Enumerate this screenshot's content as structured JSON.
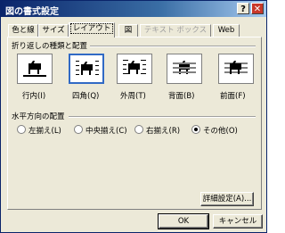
{
  "window": {
    "title": "図の書式設定",
    "help_glyph": "?",
    "close_glyph": "✕"
  },
  "tabs": [
    {
      "label": "色と線"
    },
    {
      "label": "サイズ"
    },
    {
      "label": "レイアウト"
    },
    {
      "label": "図"
    },
    {
      "label": "テキスト ボックス"
    },
    {
      "label": "Web"
    }
  ],
  "active_tab": "レイアウト",
  "wrapping": {
    "group_label": "折り返しの種類と配置",
    "selected": "四角(Q)",
    "options": [
      {
        "label": "行内(I)",
        "icon": "wrap-inline-icon"
      },
      {
        "label": "四角(Q)",
        "icon": "wrap-square-icon"
      },
      {
        "label": "外周(T)",
        "icon": "wrap-tight-icon"
      },
      {
        "label": "背面(B)",
        "icon": "wrap-behind-icon"
      },
      {
        "label": "前面(F)",
        "icon": "wrap-front-icon"
      }
    ]
  },
  "horizontal_alignment": {
    "group_label": "水平方向の配置",
    "selected": "その他(O)",
    "options": [
      {
        "label": "左揃え(L)"
      },
      {
        "label": "中央揃え(C)"
      },
      {
        "label": "右揃え(R)"
      },
      {
        "label": "その他(O)"
      }
    ]
  },
  "buttons": {
    "advanced": "詳細設定(A)...",
    "ok": "OK",
    "cancel": "キャンセル"
  },
  "colors": {
    "title_bar": "#0a246a",
    "dialog_bg": "#ece9d8",
    "selection": "#316ac5"
  }
}
